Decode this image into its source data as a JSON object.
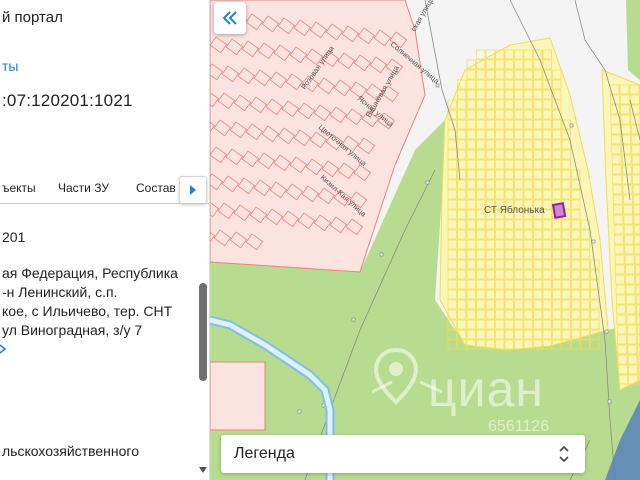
{
  "panel": {
    "portal_title": "й портал",
    "objects_link": "ты",
    "cadastral_number": ":07:120201:1021",
    "tabs": [
      {
        "label": "ъекты"
      },
      {
        "label": "Части ЗУ"
      },
      {
        "label": "Состав"
      }
    ],
    "cad_short": "201",
    "address_lines": [
      "ая Федерация, Республика",
      "-н Ленинский, с.п.",
      "кое, с Ильичево, тер. СНТ",
      " ул Виноградная, з/у 7"
    ],
    "land_category": "льскохозяйственного"
  },
  "map": {
    "street_labels": [
      {
        "text": "Розовая улица"
      },
      {
        "text": "Вишнёвая улица"
      },
      {
        "text": "Солнечная улица"
      },
      {
        "text": "Ясная улица"
      },
      {
        "text": "Цветочная улица"
      },
      {
        "text": "Кизил-Кая улица"
      },
      {
        "text": "ская улица"
      }
    ],
    "snt_label": "СТ Яблонька",
    "legend_label": "Легенда",
    "watermark_text": "циан",
    "watermark_number": "6561126",
    "colors": {
      "green": "#b8dc8f",
      "parcel_red": "#e8837a",
      "parcel_red_fill": "#fbe3e0",
      "parcel_yellow": "#eedd55",
      "parcel_yellow_fill": "#fbf6b8",
      "selected": "#9b1c9b",
      "water": "#7fbfe6"
    }
  }
}
